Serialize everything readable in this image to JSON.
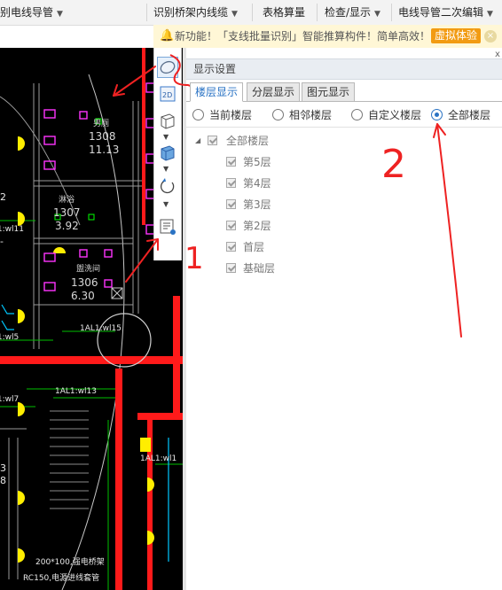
{
  "menubar": {
    "items": [
      {
        "label": "别电线导管"
      },
      {
        "label": "识别桥架内线缆"
      },
      {
        "label": "表格算量"
      },
      {
        "label": "检查/显示"
      },
      {
        "label": "电线导管二次编辑"
      }
    ]
  },
  "notice": {
    "message": "新功能！「支线批量识别」智能推算构件！简单高效！",
    "cta": "虚拟体验",
    "close": "×"
  },
  "cad": {
    "rooms": [
      {
        "name": "男厕",
        "area": "1308",
        "height": "11.13"
      },
      {
        "name": "淋浴",
        "area": "1307",
        "height": "3.92"
      },
      {
        "name": "盥洗间",
        "area": "1306",
        "height": "6.30"
      }
    ],
    "labels": [
      "1AL1:wl15",
      "1AL1:wl13",
      "1AL1:wl11",
      "1AL1:wl5",
      "1AL1:wl7",
      "1AL1:wl1",
      "200*100,强电桥架",
      "RC150,电源进线套管"
    ],
    "fragments": [
      "2",
      "3",
      "8",
      "-"
    ],
    "toolbar_icons": [
      "2D"
    ]
  },
  "panel": {
    "title": "显示设置",
    "pin": "x",
    "tabs": [
      {
        "label": "楼层显示",
        "active": true
      },
      {
        "label": "分层显示",
        "active": false
      },
      {
        "label": "图元显示",
        "active": false
      }
    ],
    "radios": [
      {
        "label": "当前楼层",
        "selected": false
      },
      {
        "label": "相邻楼层",
        "selected": false
      },
      {
        "label": "自定义楼层",
        "selected": false
      },
      {
        "label": "全部楼层",
        "selected": true
      }
    ],
    "tree": {
      "root": {
        "label": "全部楼层",
        "checked": true
      },
      "children": [
        {
          "label": "第5层",
          "checked": true
        },
        {
          "label": "第4层",
          "checked": true
        },
        {
          "label": "第3层",
          "checked": true
        },
        {
          "label": "第2层",
          "checked": true
        },
        {
          "label": "首层",
          "checked": true
        },
        {
          "label": "基础层",
          "checked": true
        }
      ]
    }
  },
  "annotations": [
    "1",
    "2"
  ],
  "colors": {
    "accent": "#2a73c4",
    "cad_background": "#000000",
    "wire_red": "#ff1a1a",
    "symbol_yellow": "#ffee00",
    "symbol_magenta": "#ff33ff",
    "cta_orange": "#f29b12",
    "annotation_red": "#ee2222"
  }
}
